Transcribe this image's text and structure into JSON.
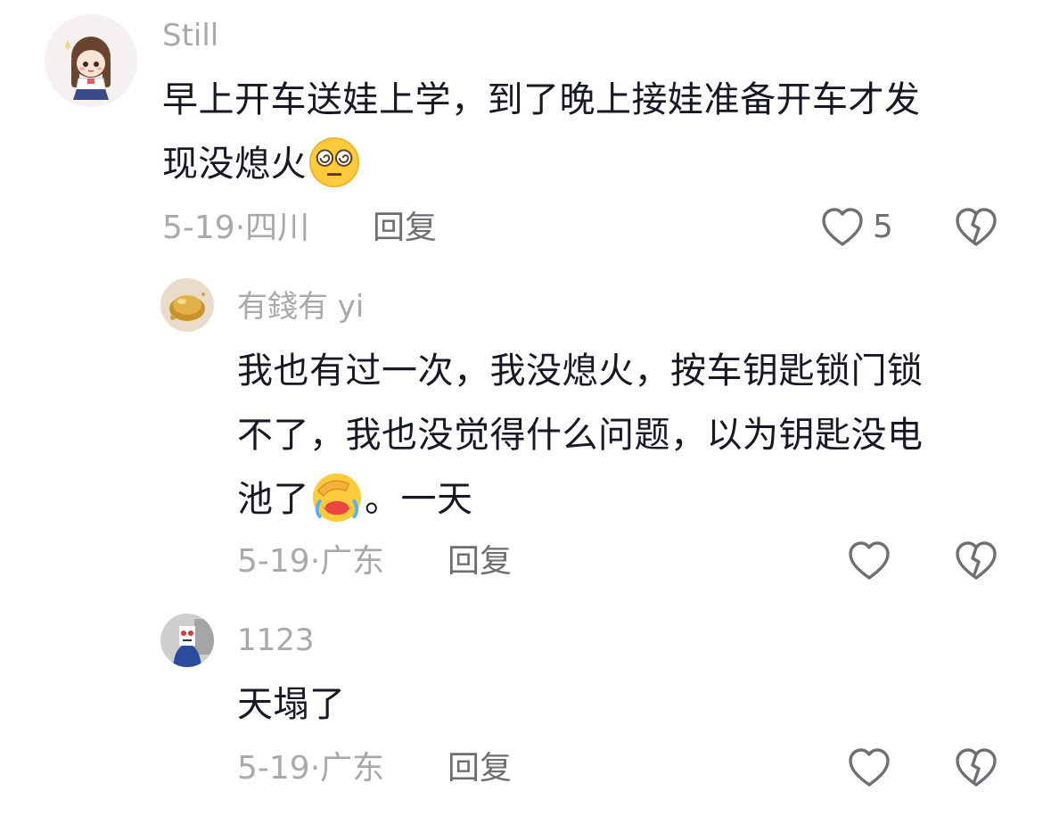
{
  "comments": [
    {
      "username": "Still",
      "text_lines": [
        "早上开车送娃上学，到了晚上接娃准备开车才发",
        "现没熄火"
      ],
      "emoji_1": "dizzy-eyes-emoji",
      "date": "5-19",
      "separator": "·",
      "location": "四川",
      "reply_label": "回复",
      "like_count": "5"
    },
    {
      "username": "有錢有 yi",
      "text_lines": [
        "我也有过一次，我没熄火，按车钥匙锁门锁",
        "不了，我也没觉得什么问题，以为钥匙没电",
        "池了",
        "。一天"
      ],
      "emoji_1": "face-palm-crying-emoji",
      "date": "5-19",
      "separator": "·",
      "location": "广东",
      "reply_label": "回复",
      "like_count": ""
    },
    {
      "username": "1123",
      "text_lines": [
        "天塌了"
      ],
      "date": "5-19",
      "separator": "·",
      "location": "广东",
      "reply_label": "回复",
      "like_count": ""
    }
  ],
  "colors": {
    "text": "#161823",
    "muted": "#a9a9ad",
    "action": "#6e6e73"
  },
  "icons": [
    "heart-outline-icon",
    "broken-heart-icon"
  ]
}
